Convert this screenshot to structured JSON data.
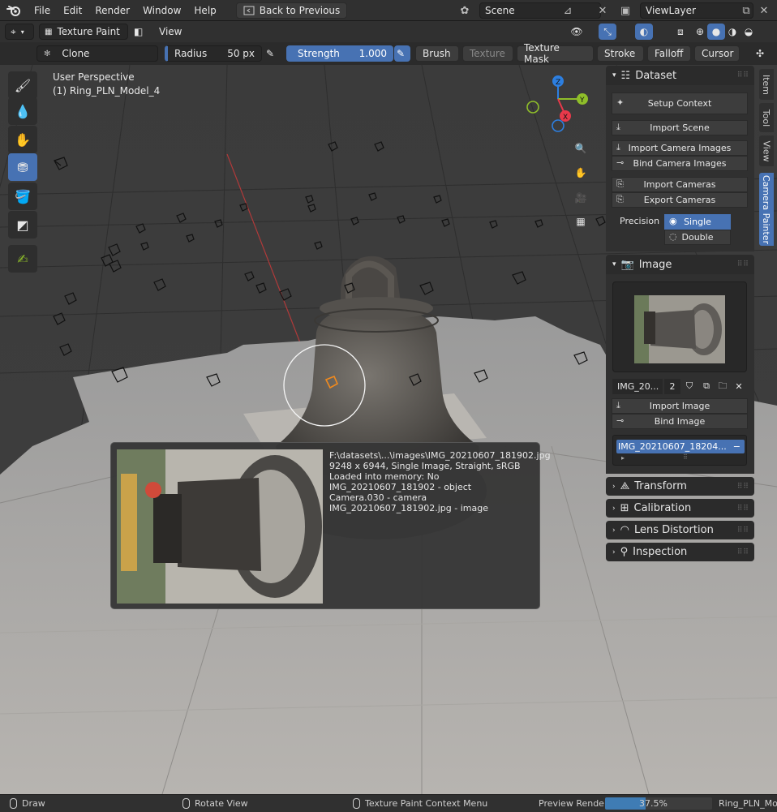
{
  "menubar": {
    "items": [
      "File",
      "Edit",
      "Render",
      "Window",
      "Help"
    ],
    "back_to_previous": "Back to Previous",
    "scene": "Scene",
    "view_layer": "ViewLayer"
  },
  "header": {
    "mode": "Texture Paint",
    "view": "View"
  },
  "tool_settings": {
    "brush_name": "Clone",
    "radius_label": "Radius",
    "radius_value": "50 px",
    "strength_label": "Strength",
    "strength_value": "1.000",
    "brush": "Brush",
    "texture": "Texture",
    "texture_mask": "Texture Mask",
    "stroke": "Stroke",
    "falloff": "Falloff",
    "cursor": "Cursor"
  },
  "viewport": {
    "perspective": "User Perspective",
    "object": "(1) Ring_PLN_Model_4",
    "axis_labels": {
      "x": "X",
      "y": "Y",
      "z": "Z"
    }
  },
  "right_tabs": [
    "Item",
    "Tool",
    "View",
    "Camera Painter"
  ],
  "dataset_panel": {
    "title": "Dataset",
    "setup_context": "Setup Context",
    "import_scene": "Import Scene",
    "import_camera_images": "Import Camera Images",
    "bind_camera_images": "Bind Camera Images",
    "import_cameras": "Import Cameras",
    "export_cameras": "Export Cameras",
    "precision_label": "Precision",
    "precision_single": "Single",
    "precision_double": "Double"
  },
  "image_panel": {
    "title": "Image",
    "image_name": "IMG_20...",
    "user_count": "2",
    "import_image": "Import Image",
    "bind_image": "Bind Image",
    "list_item": "IMG_20210607_18204..."
  },
  "collapsed_panels": [
    "Transform",
    "Calibration",
    "Lens Distortion",
    "Inspection"
  ],
  "tooltip": {
    "path": "F:\\datasets\\...\\images\\IMG_20210607_181902.jpg",
    "info": "9248 x 6944, Single Image, Straight, sRGB",
    "memory": "Loaded into memory: No",
    "object": "IMG_20210607_181902 - object",
    "camera": "Camera.030 - camera",
    "image": "IMG_20210607_181902.jpg - image"
  },
  "statusbar": {
    "draw": "Draw",
    "rotate_view": "Rotate View",
    "context_menu": "Texture Paint Context Menu",
    "preview_render": "Preview Render",
    "progress_text": "37.5%",
    "progress": 0.375,
    "scene_name": "Ring_PLN_Mod"
  },
  "colors": {
    "accent": "#4772b3",
    "x_axis": "#e8394a",
    "y_axis": "#8fbe2a",
    "z_axis": "#2d7fe0",
    "active_camera": "#f08a1e"
  }
}
